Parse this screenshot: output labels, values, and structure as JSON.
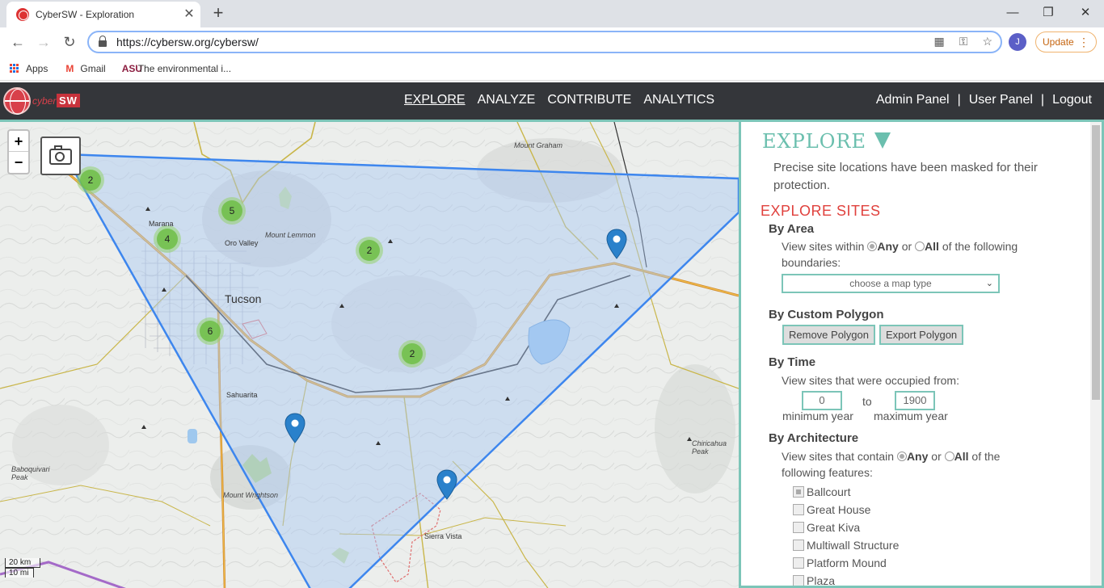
{
  "browser": {
    "tab_title": "CyberSW - Exploration",
    "url": "https://cybersw.org/cybersw/",
    "update_label": "Update",
    "avatar_initial": "J",
    "bookmarks": [
      {
        "label": "Apps",
        "icon": "apps-grid-icon"
      },
      {
        "label": "Gmail",
        "icon": "gmail-icon"
      },
      {
        "label": "The environmental i...",
        "icon": "asu-icon"
      }
    ]
  },
  "header": {
    "logo_cyber": "cyber",
    "logo_sw": "SW",
    "nav": [
      "EXPLORE",
      "ANALYZE",
      "CONTRIBUTE",
      "ANALYTICS"
    ],
    "active_nav": "EXPLORE",
    "user_links": [
      "Admin Panel",
      "User Panel",
      "Logout"
    ]
  },
  "map": {
    "clusters": [
      "2",
      "5",
      "4",
      "2",
      "6",
      "2"
    ],
    "labels": [
      "Mount Graham",
      "Marana",
      "Oro Valley",
      "Mount Lemmon",
      "Tucson",
      "Sahuarita",
      "Baboquivari Peak",
      "Mount Wrightson",
      "Sierra Vista",
      "Chiricahua Peak"
    ],
    "scale_km": "20 km",
    "scale_mi": "10 mi",
    "zoom_in": "+",
    "zoom_out": "−"
  },
  "panel": {
    "title": "EXPLORE",
    "description": "Precise site locations have been masked for their protection.",
    "section_title": "EXPLORE SITES",
    "by_area": {
      "heading": "By Area",
      "text_before": "View sites within",
      "any": "Any",
      "or": "or",
      "all": "All",
      "text_after": "of the following",
      "text_line2": "boundaries:",
      "select_placeholder": "choose a map type"
    },
    "by_polygon": {
      "heading": "By Custom Polygon",
      "remove": "Remove Polygon",
      "export": "Export Polygon"
    },
    "by_time": {
      "heading": "By Time",
      "text": "View sites that were occupied from:",
      "min_value": "0",
      "max_value": "1900",
      "to": "to",
      "min_label": "minimum year",
      "max_label": "maximum year"
    },
    "by_architecture": {
      "heading": "By Architecture",
      "text_before": "View sites that contain",
      "any": "Any",
      "or": "or",
      "all": "All",
      "text_after": "of the",
      "text_line2": "following features:",
      "features": [
        "Ballcourt",
        "Great House",
        "Great Kiva",
        "Multiwall Structure",
        "Platform Mound",
        "Plaza"
      ]
    }
  },
  "colors": {
    "accent": "#7cc5b8",
    "section_red": "#e0413d",
    "header_bg": "#34363a",
    "polygon_fill": "#a9c8f5",
    "polygon_stroke": "#3d86ee"
  }
}
